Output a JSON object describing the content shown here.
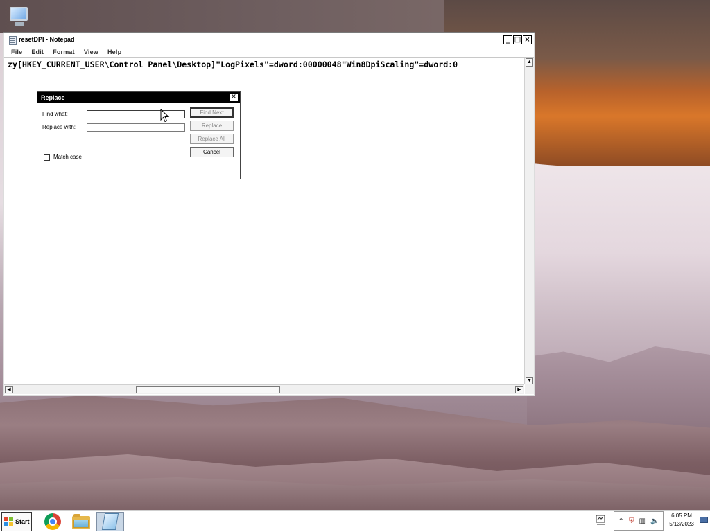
{
  "notepad": {
    "title": "resetDPI - Notepad",
    "controls": {
      "minimize": "_",
      "maximize": "□",
      "close": "×"
    },
    "menu": [
      "File",
      "Edit",
      "Format",
      "View",
      "Help"
    ],
    "content_line": "zy[HKEY_CURRENT_USER\\Control Panel\\Desktop]\"LogPixels\"=dword:00000048\"Win8DpiScaling\"=dword:0"
  },
  "replace_dialog": {
    "title": "Replace",
    "find_what_label": "Find what:",
    "find_what_value": "",
    "replace_with_label": "Replace with:",
    "replace_with_value": "",
    "match_case_label": "Match case",
    "match_case_checked": false,
    "buttons": {
      "find_next": "Find Next",
      "replace": "Replace",
      "replace_all": "Replace All",
      "cancel": "Cancel"
    }
  },
  "taskbar": {
    "start_label": "Start",
    "apps": [
      {
        "name": "chrome",
        "icon": "chrome-icon",
        "active": false
      },
      {
        "name": "file-explorer",
        "icon": "folder-icon",
        "active": false
      },
      {
        "name": "notepad",
        "icon": "notepad-icon",
        "active": true
      }
    ],
    "tray_icons": [
      "chevron-up-icon",
      "security-icon",
      "network-icon",
      "volume-icon"
    ],
    "clock": {
      "time": "6:05 PM",
      "date": "5/13/2023"
    }
  },
  "colors": {
    "dialog_titlebar": "#000000",
    "taskbar_active": "#c9d7e6",
    "start_flag": [
      "#e2452b",
      "#7cbf2f",
      "#2b8fe2",
      "#f5c230"
    ]
  }
}
